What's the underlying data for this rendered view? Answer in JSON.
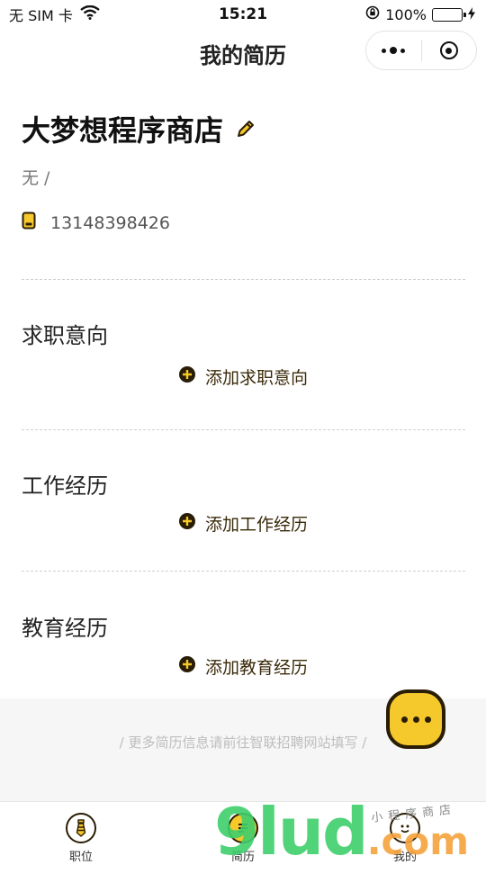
{
  "status_bar": {
    "carrier": "无 SIM 卡",
    "time": "15:21",
    "battery": "100%",
    "battery_level": 1.0
  },
  "nav": {
    "title": "我的简历"
  },
  "profile": {
    "name": "大梦想程序商店",
    "sub": "无 /",
    "phone": "13148398426"
  },
  "sections": {
    "intent": {
      "title": "求职意向",
      "add_label": "添加求职意向"
    },
    "work": {
      "title": "工作经历",
      "add_label": "添加工作经历"
    },
    "edu": {
      "title": "教育经历",
      "add_label": "添加教育经历"
    }
  },
  "note": "/ 更多简历信息请前往智联招聘网站填写 /",
  "tabs": [
    {
      "label": "职位",
      "icon": "tie-icon"
    },
    {
      "label": "简历",
      "icon": "resume-icon"
    },
    {
      "label": "我的",
      "icon": "profile-face-icon"
    }
  ],
  "watermark": {
    "main": "9lud",
    "domain": ".com",
    "small": "小程序商店"
  },
  "colors": {
    "accent": "#f5c92c",
    "dark": "#2a1d05",
    "battery": "#35c24a"
  }
}
